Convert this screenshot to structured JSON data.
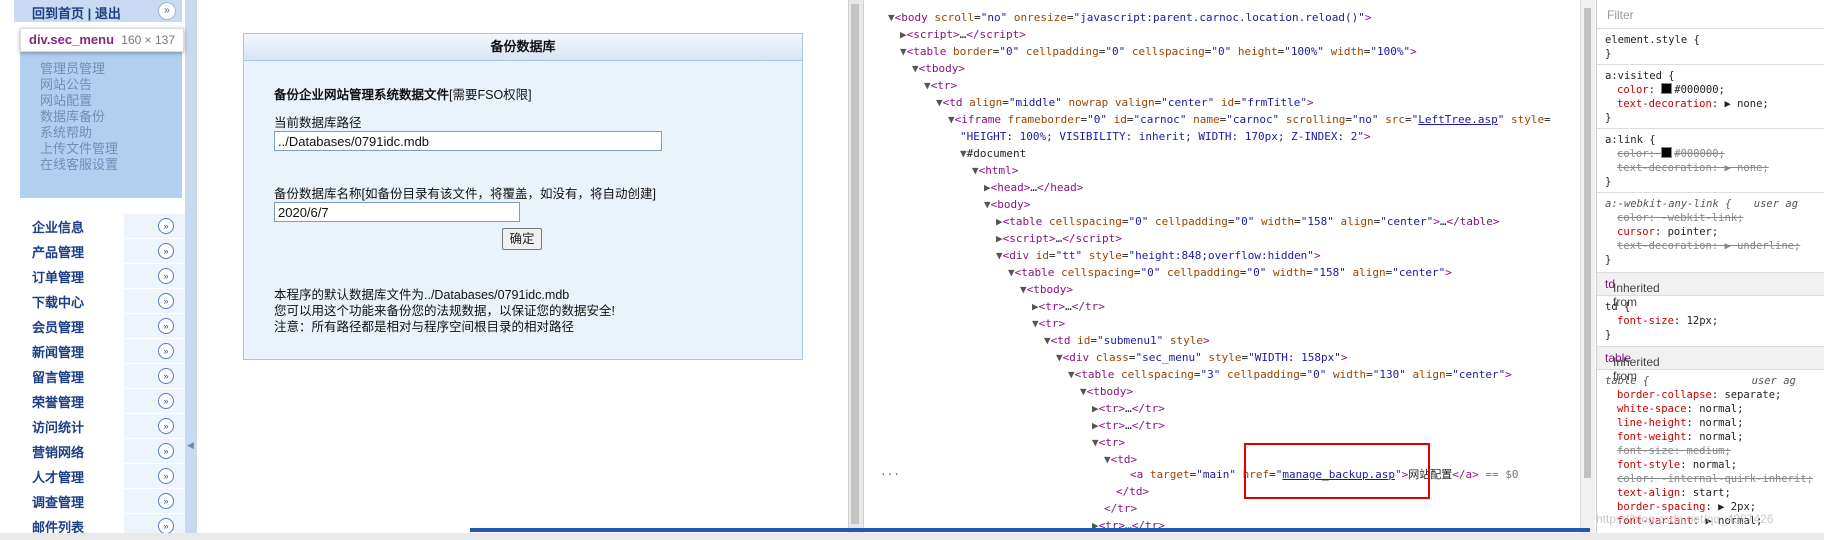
{
  "left_nav": {
    "top_links": "回到首页 | 退出",
    "inspector_tip": {
      "tag": "div.sec_menu",
      "dims": "160 × 137"
    },
    "submenu_items": [
      "管理员管理",
      "网站公告",
      "网站配置",
      "数据库备份",
      "系统帮助",
      "上传文件管理",
      "在线客服设置"
    ],
    "menu_items": [
      "企业信息",
      "产品管理",
      "订单管理",
      "下载中心",
      "会员管理",
      "新闻管理",
      "留言管理",
      "荣誉管理",
      "访问统计",
      "营销网络",
      "人才管理",
      "调查管理",
      "邮件列表"
    ]
  },
  "panel": {
    "title": "备份数据库",
    "heading": "备份企业网站管理系统数据文件",
    "heading_note": "[需要FSO权限]",
    "path_label": "当前数据库路径",
    "path_value": "../Databases/0791idc.mdb",
    "name_label": "备份数据库名称[如备份目录有该文件，将覆盖，如没有，将自动创建]",
    "name_value": "2020/6/7",
    "confirm": "确定",
    "note1": "本程序的默认数据库文件为../Databases/0791idc.mdb",
    "note2": "您可以用这个功能来备份您的法规数据，以保证您的数据安全!",
    "note3": "注意：所有路径都是相对与程序空间根目录的相对路径"
  },
  "styles": {
    "filter_placeholder": "Filter",
    "element_style": "element.style {",
    "a_visited": "a:visited {",
    "a_visited_color": "#000000;",
    "a_link": "a:link {",
    "webkit_any_link": "a:-webkit-any-link {",
    "ua": "user ag",
    "inherited_td": "Inherited from",
    "td_rule": "td {",
    "td_font_size": "12px;",
    "inherited_table": "Inherited from",
    "table_rule": "table {"
  },
  "watermark": "https://blog.csdn.net/qq_4387426"
}
